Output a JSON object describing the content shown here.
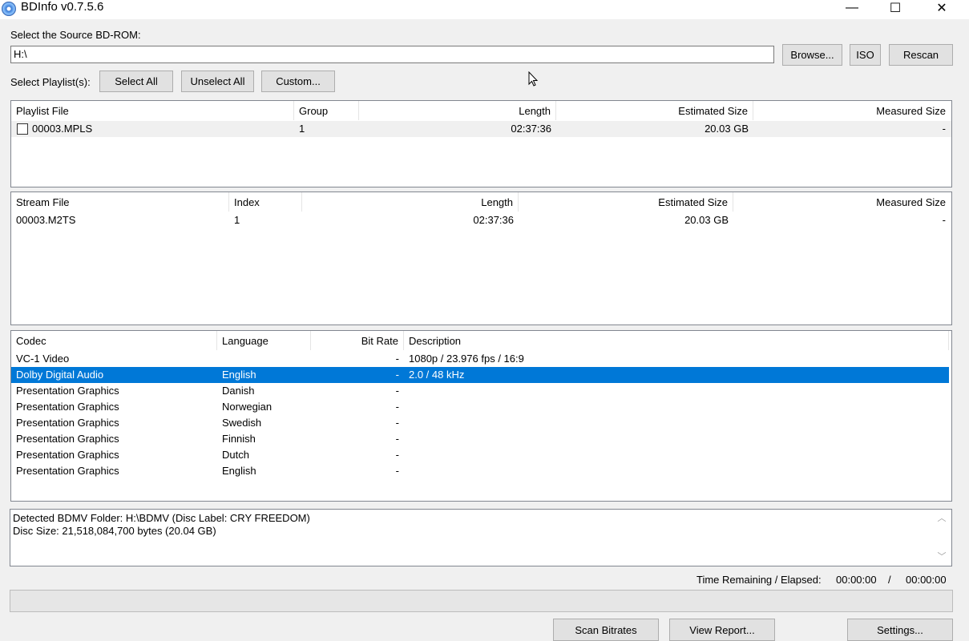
{
  "window": {
    "title": "BDInfo v0.7.5.6",
    "minimize": "—",
    "maximize": "☐",
    "close": "✕"
  },
  "source": {
    "label": "Select the Source BD-ROM:",
    "path": "H:\\",
    "browse": "Browse...",
    "iso": "ISO",
    "rescan": "Rescan"
  },
  "playlist_controls": {
    "label": "Select Playlist(s):",
    "select_all": "Select All",
    "unselect_all": "Unselect All",
    "custom": "Custom..."
  },
  "playlists": {
    "headers": [
      "Playlist File",
      "Group",
      "Length",
      "Estimated Size",
      "Measured Size"
    ],
    "rows": [
      {
        "file": "00003.MPLS",
        "group": "1",
        "length": "02:37:36",
        "estimated": "20.03 GB",
        "measured": "-",
        "checked": false
      }
    ]
  },
  "streams": {
    "headers": [
      "Stream File",
      "Index",
      "Length",
      "Estimated Size",
      "Measured Size"
    ],
    "rows": [
      {
        "file": "00003.M2TS",
        "index": "1",
        "length": "02:37:36",
        "estimated": "20.03 GB",
        "measured": "-"
      }
    ]
  },
  "codecs": {
    "headers": [
      "Codec",
      "Language",
      "Bit Rate",
      "Description"
    ],
    "rows": [
      {
        "codec": "VC-1 Video",
        "language": "",
        "bitrate": "-",
        "description": "1080p / 23.976 fps / 16:9",
        "selected": false
      },
      {
        "codec": "Dolby Digital Audio",
        "language": "English",
        "bitrate": "-",
        "description": "2.0 / 48 kHz",
        "selected": true
      },
      {
        "codec": "Presentation Graphics",
        "language": "Danish",
        "bitrate": "-",
        "description": "",
        "selected": false
      },
      {
        "codec": "Presentation Graphics",
        "language": "Norwegian",
        "bitrate": "-",
        "description": "",
        "selected": false
      },
      {
        "codec": "Presentation Graphics",
        "language": "Swedish",
        "bitrate": "-",
        "description": "",
        "selected": false
      },
      {
        "codec": "Presentation Graphics",
        "language": "Finnish",
        "bitrate": "-",
        "description": "",
        "selected": false
      },
      {
        "codec": "Presentation Graphics",
        "language": "Dutch",
        "bitrate": "-",
        "description": "",
        "selected": false
      },
      {
        "codec": "Presentation Graphics",
        "language": "English",
        "bitrate": "-",
        "description": "",
        "selected": false
      }
    ]
  },
  "status": {
    "line1": "Detected BDMV Folder: H:\\BDMV (Disc Label: CRY FREEDOM)",
    "line2": "Disc Size: 21,518,084,700 bytes (20.04 GB)"
  },
  "timer": {
    "label": "Time Remaining / Elapsed:",
    "remaining": "00:00:00",
    "separator": "/",
    "elapsed": "00:00:00"
  },
  "progress": {
    "fraction": 0
  },
  "footer": {
    "scan_bitrates": "Scan Bitrates",
    "view_report": "View Report...",
    "settings": "Settings..."
  },
  "colors": {
    "selection": "#0078d7",
    "background": "#f0f0f0"
  }
}
